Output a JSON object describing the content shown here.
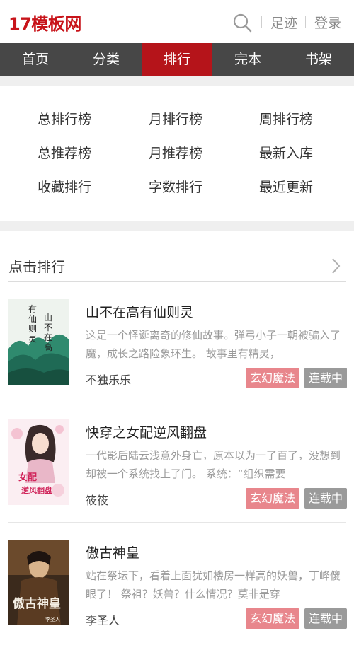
{
  "header": {
    "logo": "17模板网",
    "links": [
      "足迹",
      "登录"
    ]
  },
  "nav": {
    "items": [
      "首页",
      "分类",
      "排行",
      "完本",
      "书架"
    ],
    "active": "排行"
  },
  "ranking_links": [
    [
      "总排行榜",
      "月排行榜",
      "周排行榜"
    ],
    [
      "总推荐榜",
      "月推荐榜",
      "最新入库"
    ],
    [
      "收藏排行",
      "字数排行",
      "最近更新"
    ]
  ],
  "section": {
    "title": "点击排行"
  },
  "books": [
    {
      "title": "山不在高有仙则灵",
      "description": "这是一个怪诞离奇的修仙故事。弹弓小子一朝被骗入了魔，成长之路险象环生。 故事里有精灵，",
      "author": "不独乐乐",
      "genre": "玄幻魔法",
      "status": "连载中",
      "cover_text": "有仙则灵"
    },
    {
      "title": "快穿之女配逆风翻盘",
      "description": "一代影后陆云浅意外身亡，原本以为一了百了，没想到却被一个系统找上了门。 系统：“组织需要",
      "author": "筱筱",
      "genre": "玄幻魔法",
      "status": "连载中",
      "cover_text": "女配逆风翻盘"
    },
    {
      "title": "傲古神皇",
      "description": "站在祭坛下，看着上面犹如楼房一样高的妖兽，丁峰傻眼了！ 祭祖？妖兽？什么情况？莫非是穿",
      "author": "李圣人",
      "genre": "玄幻魔法",
      "status": "连载中",
      "cover_text": "傲古神皇"
    }
  ],
  "colors": {
    "brand": "#c8141a",
    "nav_bg": "#474747",
    "nav_active": "#b5141a",
    "tag_genre": "#e8868c",
    "tag_status": "#9a9a9a"
  }
}
